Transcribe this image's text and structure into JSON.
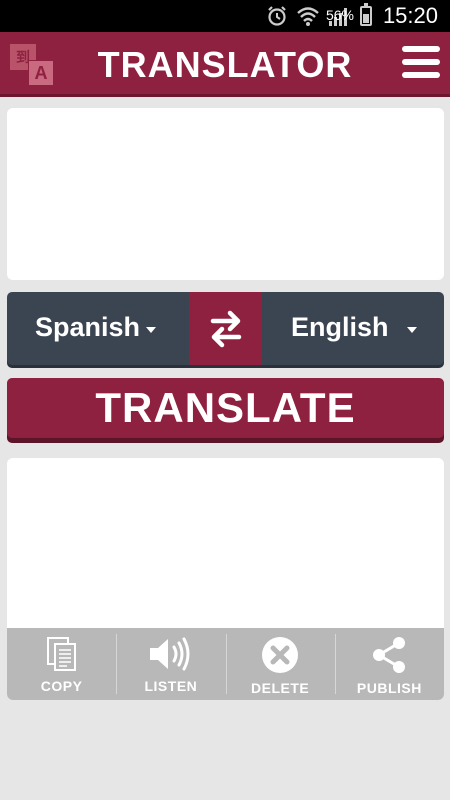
{
  "status_bar": {
    "battery_percent": "56%",
    "time": "15:20",
    "icons": [
      "alarm-icon",
      "wifi-icon",
      "signal-icon",
      "battery-icon"
    ]
  },
  "header": {
    "title": "TRANSLATOR",
    "logo_glyphs": [
      "到",
      "A"
    ],
    "menu_icon": "hamburger-menu-icon",
    "color": "#8e2140"
  },
  "input": {
    "value": "",
    "placeholder": ""
  },
  "languages": {
    "from": "Spanish",
    "to": "English",
    "swap_icon": "swap-arrows-icon",
    "bar_color": "#3b4451"
  },
  "translate_button": {
    "label": "TRANSLATE"
  },
  "output": {
    "value": ""
  },
  "actions": [
    {
      "label": "COPY",
      "icon": "copy-icon"
    },
    {
      "label": "LISTEN",
      "icon": "speaker-icon"
    },
    {
      "label": "DELETE",
      "icon": "delete-icon"
    },
    {
      "label": "PUBLISH",
      "icon": "share-icon"
    }
  ]
}
